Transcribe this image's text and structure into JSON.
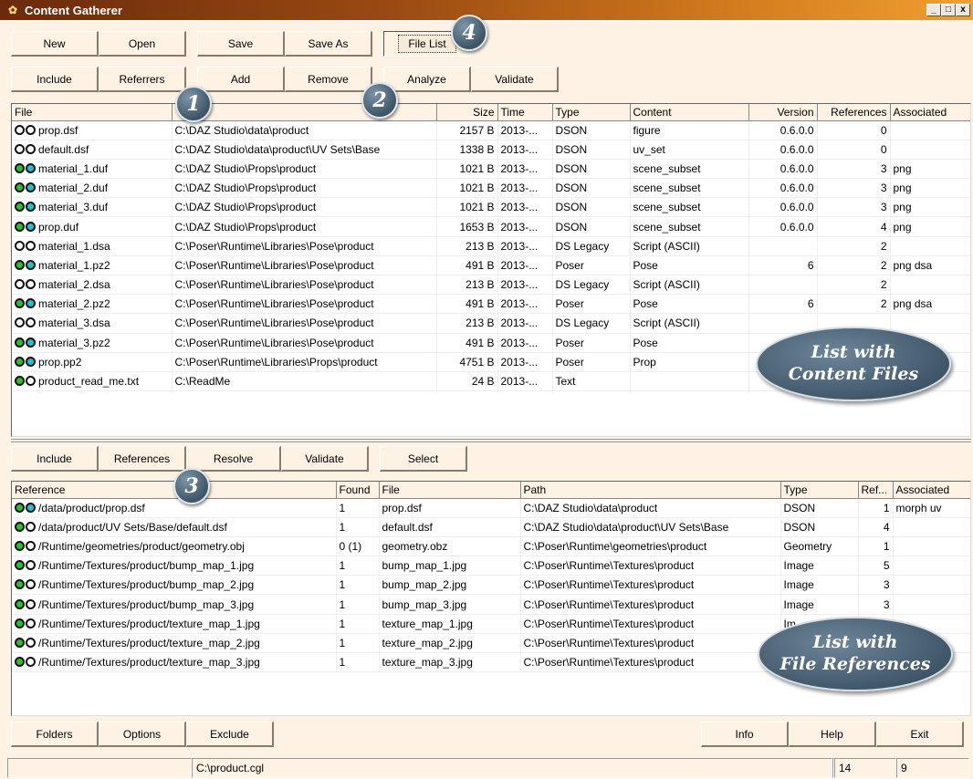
{
  "window": {
    "title": "Content Gatherer",
    "controls": [
      "_",
      "□",
      "x"
    ]
  },
  "toolbar1": [
    "New",
    "Open",
    "Save",
    "Save As",
    "File List"
  ],
  "toolbar2": [
    "Include",
    "Referrers",
    "Add",
    "Remove",
    "Analyze",
    "Validate"
  ],
  "badges": {
    "b1": "1",
    "b2": "2",
    "b3": "3",
    "b4": "4"
  },
  "callouts": {
    "content": {
      "line1": "List with",
      "line2": "Content Files"
    },
    "refs": {
      "line1": "List with",
      "line2": "File References"
    }
  },
  "files_table": {
    "headers": [
      "File",
      "",
      "Size",
      "Time",
      "Type",
      "Content",
      "Version",
      "References",
      "Associated"
    ],
    "rows": [
      {
        "s": [
          "white",
          "white"
        ],
        "file": "prop.dsf",
        "path": "C:\\DAZ Studio\\data\\product",
        "size": "2157 B",
        "time": "2013-...",
        "type": "DSON",
        "content": "figure",
        "version": "0.6.0.0",
        "refs": "0",
        "assoc": ""
      },
      {
        "s": [
          "white",
          "white"
        ],
        "file": "default.dsf",
        "path": "C:\\DAZ Studio\\data\\product\\UV Sets\\Base",
        "size": "1338 B",
        "time": "2013-...",
        "type": "DSON",
        "content": "uv_set",
        "version": "0.6.0.0",
        "refs": "0",
        "assoc": ""
      },
      {
        "s": [
          "green",
          "cyan"
        ],
        "file": "material_1.duf",
        "path": "C:\\DAZ Studio\\Props\\product",
        "size": "1021 B",
        "time": "2013-...",
        "type": "DSON",
        "content": "scene_subset",
        "version": "0.6.0.0",
        "refs": "3",
        "assoc": "png"
      },
      {
        "s": [
          "green",
          "cyan"
        ],
        "file": "material_2.duf",
        "path": "C:\\DAZ Studio\\Props\\product",
        "size": "1021 B",
        "time": "2013-...",
        "type": "DSON",
        "content": "scene_subset",
        "version": "0.6.0.0",
        "refs": "3",
        "assoc": "png"
      },
      {
        "s": [
          "green",
          "cyan"
        ],
        "file": "material_3.duf",
        "path": "C:\\DAZ Studio\\Props\\product",
        "size": "1021 B",
        "time": "2013-...",
        "type": "DSON",
        "content": "scene_subset",
        "version": "0.6.0.0",
        "refs": "3",
        "assoc": "png"
      },
      {
        "s": [
          "green",
          "cyan"
        ],
        "file": "prop.duf",
        "path": "C:\\DAZ Studio\\Props\\product",
        "size": "1653 B",
        "time": "2013-...",
        "type": "DSON",
        "content": "scene_subset",
        "version": "0.6.0.0",
        "refs": "4",
        "assoc": "png"
      },
      {
        "s": [
          "white",
          "white"
        ],
        "file": "material_1.dsa",
        "path": "C:\\Poser\\Runtime\\Libraries\\Pose\\product",
        "size": "213 B",
        "time": "2013-...",
        "type": "DS Legacy",
        "content": "Script (ASCII)",
        "version": "",
        "refs": "2",
        "assoc": ""
      },
      {
        "s": [
          "green",
          "cyan"
        ],
        "file": "material_1.pz2",
        "path": "C:\\Poser\\Runtime\\Libraries\\Pose\\product",
        "size": "491 B",
        "time": "2013-...",
        "type": "Poser",
        "content": "Pose",
        "version": "6",
        "refs": "2",
        "assoc": "png dsa"
      },
      {
        "s": [
          "white",
          "white"
        ],
        "file": "material_2.dsa",
        "path": "C:\\Poser\\Runtime\\Libraries\\Pose\\product",
        "size": "213 B",
        "time": "2013-...",
        "type": "DS Legacy",
        "content": "Script (ASCII)",
        "version": "",
        "refs": "2",
        "assoc": ""
      },
      {
        "s": [
          "green",
          "cyan"
        ],
        "file": "material_2.pz2",
        "path": "C:\\Poser\\Runtime\\Libraries\\Pose\\product",
        "size": "491 B",
        "time": "2013-...",
        "type": "Poser",
        "content": "Pose",
        "version": "6",
        "refs": "2",
        "assoc": "png dsa"
      },
      {
        "s": [
          "white",
          "white"
        ],
        "file": "material_3.dsa",
        "path": "C:\\Poser\\Runtime\\Libraries\\Pose\\product",
        "size": "213 B",
        "time": "2013-...",
        "type": "DS Legacy",
        "content": "Script (ASCII)",
        "version": "",
        "refs": "",
        "assoc": ""
      },
      {
        "s": [
          "green",
          "cyan"
        ],
        "file": "material_3.pz2",
        "path": "C:\\Poser\\Runtime\\Libraries\\Pose\\product",
        "size": "491 B",
        "time": "2013-...",
        "type": "Poser",
        "content": "Pose",
        "version": "",
        "refs": "",
        "assoc": ""
      },
      {
        "s": [
          "green",
          "cyan"
        ],
        "file": "prop.pp2",
        "path": "C:\\Poser\\Runtime\\Libraries\\Props\\product",
        "size": "4751 B",
        "time": "2013-...",
        "type": "Poser",
        "content": "Prop",
        "version": "",
        "refs": "",
        "assoc": ""
      },
      {
        "s": [
          "green",
          "white"
        ],
        "file": "product_read_me.txt",
        "path": "C:\\ReadMe",
        "size": "24 B",
        "time": "2013-...",
        "type": "Text",
        "content": "",
        "version": "",
        "refs": "",
        "assoc": ""
      }
    ]
  },
  "toolbar3": [
    "Include",
    "References",
    "Resolve",
    "Validate",
    "Select"
  ],
  "refs_table": {
    "headers": [
      "Reference",
      "Found",
      "File",
      "Path",
      "Type",
      "Ref...",
      "Associated"
    ],
    "rows": [
      {
        "s": [
          "green",
          "cyan"
        ],
        "ref": "/data/product/prop.dsf",
        "found": "1",
        "file": "prop.dsf",
        "path": "C:\\DAZ Studio\\data\\product",
        "type": "DSON",
        "n": "1",
        "assoc": "morph uv"
      },
      {
        "s": [
          "green",
          "white"
        ],
        "ref": "/data/product/UV Sets/Base/default.dsf",
        "found": "1",
        "file": "default.dsf",
        "path": "C:\\DAZ Studio\\data\\product\\UV Sets\\Base",
        "type": "DSON",
        "n": "4",
        "assoc": ""
      },
      {
        "s": [
          "green",
          "white"
        ],
        "ref": "/Runtime/geometries/product/geometry.obj",
        "found": "0 (1)",
        "file": "geometry.obz",
        "path": "C:\\Poser\\Runtime\\geometries\\product",
        "type": "Geometry",
        "n": "1",
        "assoc": ""
      },
      {
        "s": [
          "green",
          "white"
        ],
        "ref": "/Runtime/Textures/product/bump_map_1.jpg",
        "found": "1",
        "file": "bump_map_1.jpg",
        "path": "C:\\Poser\\Runtime\\Textures\\product",
        "type": "Image",
        "n": "5",
        "assoc": ""
      },
      {
        "s": [
          "green",
          "white"
        ],
        "ref": "/Runtime/Textures/product/bump_map_2.jpg",
        "found": "1",
        "file": "bump_map_2.jpg",
        "path": "C:\\Poser\\Runtime\\Textures\\product",
        "type": "Image",
        "n": "3",
        "assoc": ""
      },
      {
        "s": [
          "green",
          "white"
        ],
        "ref": "/Runtime/Textures/product/bump_map_3.jpg",
        "found": "1",
        "file": "bump_map_3.jpg",
        "path": "C:\\Poser\\Runtime\\Textures\\product",
        "type": "Image",
        "n": "3",
        "assoc": ""
      },
      {
        "s": [
          "green",
          "white"
        ],
        "ref": "/Runtime/Textures/product/texture_map_1.jpg",
        "found": "1",
        "file": "texture_map_1.jpg",
        "path": "C:\\Poser\\Runtime\\Textures\\product",
        "type": "Im",
        "n": "",
        "assoc": ""
      },
      {
        "s": [
          "green",
          "white"
        ],
        "ref": "/Runtime/Textures/product/texture_map_2.jpg",
        "found": "1",
        "file": "texture_map_2.jpg",
        "path": "C:\\Poser\\Runtime\\Textures\\product",
        "type": "",
        "n": "",
        "assoc": ""
      },
      {
        "s": [
          "green",
          "white"
        ],
        "ref": "/Runtime/Textures/product/texture_map_3.jpg",
        "found": "1",
        "file": "texture_map_3.jpg",
        "path": "C:\\Poser\\Runtime\\Textures\\product",
        "type": "",
        "n": "",
        "assoc": ""
      }
    ]
  },
  "toolbar_bottom_left": [
    "Folders",
    "Options",
    "Exclude"
  ],
  "toolbar_bottom_right": [
    "Info",
    "Help",
    "Exit"
  ],
  "statusbar": {
    "s1": "",
    "s2": "C:\\product.cgl",
    "s3": "",
    "s4": "14",
    "s5": "9"
  },
  "colors": {
    "green": "#2bbf2b",
    "cyan": "#22c0d0",
    "title_start": "#6b2a0c",
    "title_end": "#f0a030",
    "background": "#fdf2e4"
  }
}
